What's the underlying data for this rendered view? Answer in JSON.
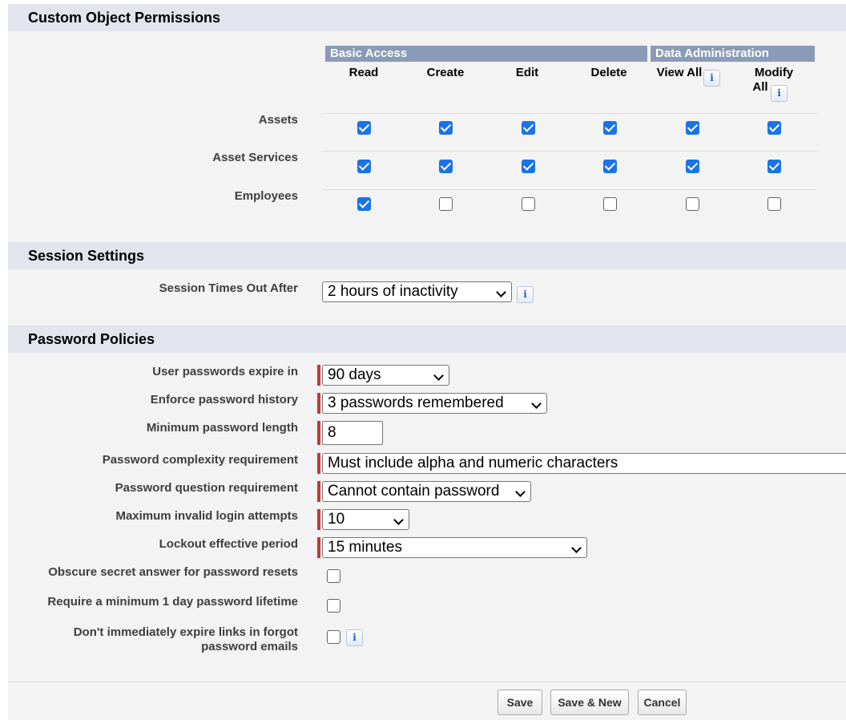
{
  "sections": {
    "custom_object_permissions": "Custom Object Permissions",
    "session_settings": "Session Settings",
    "password_policies": "Password Policies"
  },
  "permissions": {
    "groups": [
      "Basic Access",
      "Data Administration"
    ],
    "columns": [
      "Read",
      "Create",
      "Edit",
      "Delete",
      "View All",
      "Modify All"
    ],
    "column_lines": {
      "modify_all_1": "Modify",
      "modify_all_2": "All"
    },
    "rows": [
      {
        "name": "Assets",
        "checks": [
          true,
          true,
          true,
          true,
          true,
          true
        ]
      },
      {
        "name": "Asset Services",
        "checks": [
          true,
          true,
          true,
          true,
          true,
          true
        ]
      },
      {
        "name": "Employees",
        "checks": [
          true,
          false,
          false,
          false,
          false,
          false
        ]
      }
    ]
  },
  "session": {
    "timeout_label": "Session Times Out After",
    "timeout_value": "2 hours of inactivity"
  },
  "password": {
    "expire_label": "User passwords expire in",
    "expire_value": "90 days",
    "history_label": "Enforce password history",
    "history_value": "3 passwords remembered",
    "min_length_label": "Minimum password length",
    "min_length_value": "8",
    "complexity_label": "Password complexity requirement",
    "complexity_value": "Must include alpha and numeric characters",
    "question_label": "Password question requirement",
    "question_value": "Cannot contain password",
    "max_attempts_label": "Maximum invalid login attempts",
    "max_attempts_value": "10",
    "lockout_label": "Lockout effective period",
    "lockout_value": "15 minutes",
    "obscure_label": "Obscure secret answer for password resets",
    "obscure_checked": false,
    "min_lifetime_label": "Require a minimum 1 day password lifetime",
    "min_lifetime_checked": false,
    "expire_links_label_1": "Don't immediately expire links in forgot",
    "expire_links_label_2": "password emails",
    "expire_links_checked": false
  },
  "buttons": {
    "save": "Save",
    "save_new": "Save & New",
    "cancel": "Cancel"
  },
  "icons": {
    "info": "i"
  },
  "colors": {
    "section_bg": "#e2e5ee",
    "group_bar": "#8b9bb7",
    "required": "#c23934",
    "checkbox": "#1a73e8"
  }
}
